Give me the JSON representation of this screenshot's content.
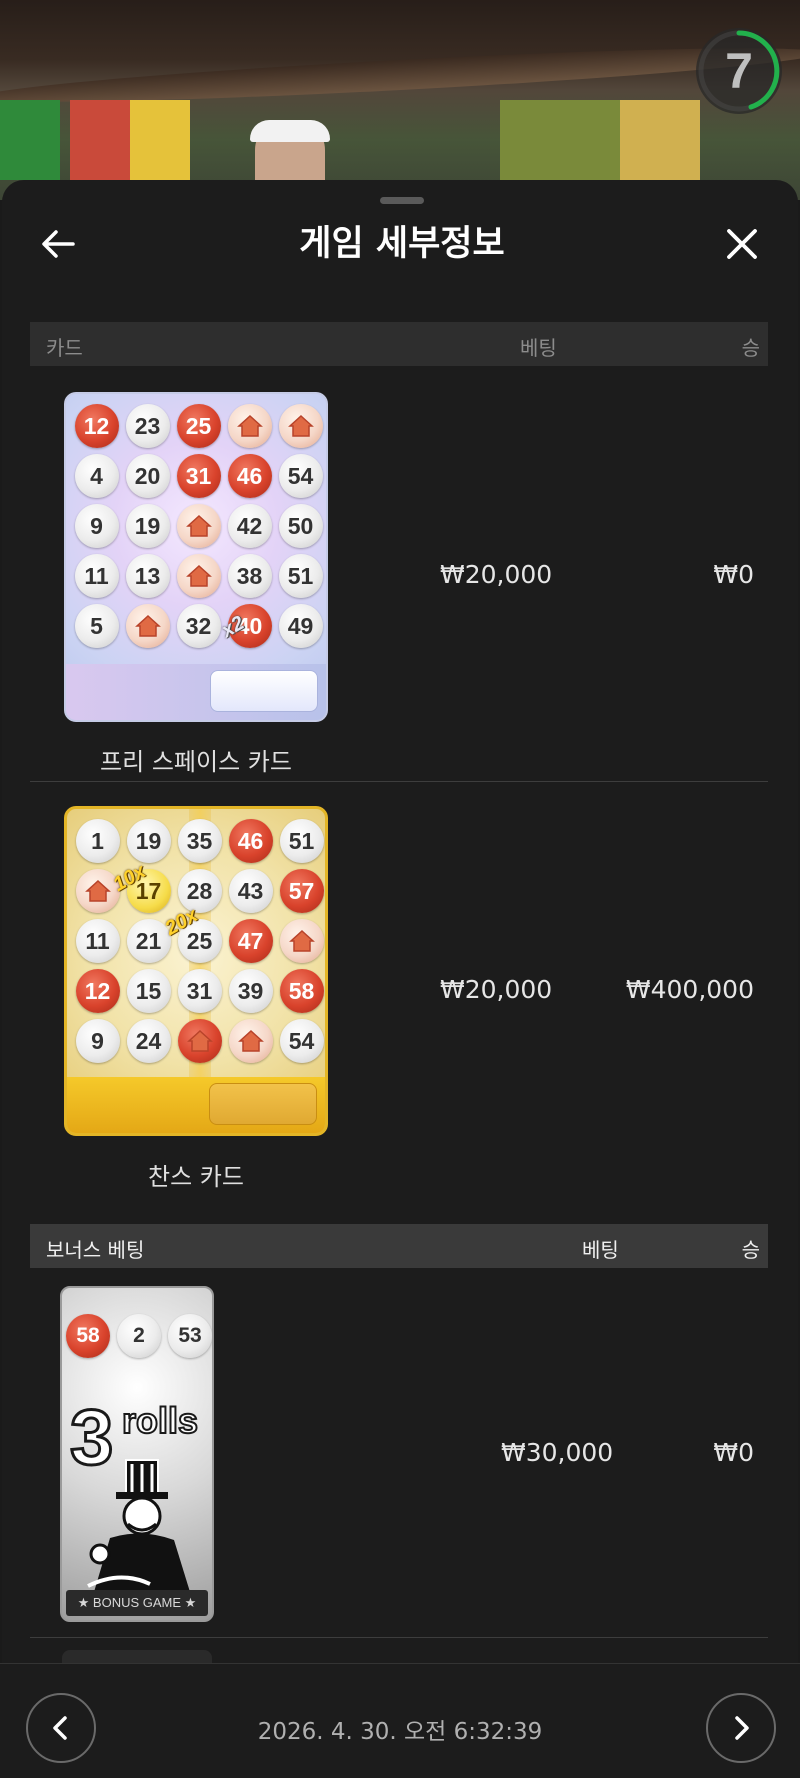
{
  "header": {
    "title": "게임 세부정보",
    "timer": "7"
  },
  "table": {
    "columns": {
      "card": "카드",
      "bet": "베팅",
      "win": "승"
    },
    "rows": [
      {
        "card_name": "프리 스페이스 카드",
        "bet": "₩20,000",
        "win": "₩0",
        "multiplier_labels": [
          "x2"
        ],
        "grid": [
          {
            "v": "12",
            "s": "hit"
          },
          {
            "v": "23",
            "s": "plain"
          },
          {
            "v": "25",
            "s": "hit"
          },
          {
            "v": "",
            "s": "house"
          },
          {
            "v": "",
            "s": "house"
          },
          {
            "v": "4",
            "s": "plain"
          },
          {
            "v": "20",
            "s": "plain"
          },
          {
            "v": "31",
            "s": "hit"
          },
          {
            "v": "46",
            "s": "hit"
          },
          {
            "v": "54",
            "s": "plain"
          },
          {
            "v": "9",
            "s": "plain"
          },
          {
            "v": "19",
            "s": "plain"
          },
          {
            "v": "",
            "s": "house"
          },
          {
            "v": "42",
            "s": "plain"
          },
          {
            "v": "50",
            "s": "plain"
          },
          {
            "v": "11",
            "s": "plain"
          },
          {
            "v": "13",
            "s": "plain"
          },
          {
            "v": "",
            "s": "house"
          },
          {
            "v": "38",
            "s": "plain"
          },
          {
            "v": "51",
            "s": "plain"
          },
          {
            "v": "5",
            "s": "plain"
          },
          {
            "v": "",
            "s": "house"
          },
          {
            "v": "32",
            "s": "plain"
          },
          {
            "v": "40",
            "s": "hit"
          },
          {
            "v": "49",
            "s": "plain"
          }
        ]
      },
      {
        "card_name": "찬스 카드",
        "bet": "₩20,000",
        "win": "₩400,000",
        "multiplier_labels": [
          "10x",
          "20x"
        ],
        "grid": [
          {
            "v": "1",
            "s": "plain"
          },
          {
            "v": "19",
            "s": "plain"
          },
          {
            "v": "35",
            "s": "plain"
          },
          {
            "v": "46",
            "s": "hit"
          },
          {
            "v": "51",
            "s": "plain"
          },
          {
            "v": "",
            "s": "house"
          },
          {
            "v": "17",
            "s": "gold"
          },
          {
            "v": "28",
            "s": "plain"
          },
          {
            "v": "43",
            "s": "plain"
          },
          {
            "v": "57",
            "s": "hit"
          },
          {
            "v": "11",
            "s": "plain"
          },
          {
            "v": "21",
            "s": "plain"
          },
          {
            "v": "25",
            "s": "plain"
          },
          {
            "v": "47",
            "s": "hit"
          },
          {
            "v": "",
            "s": "house"
          },
          {
            "v": "12",
            "s": "hit"
          },
          {
            "v": "15",
            "s": "plain"
          },
          {
            "v": "31",
            "s": "plain"
          },
          {
            "v": "39",
            "s": "plain"
          },
          {
            "v": "58",
            "s": "hit"
          },
          {
            "v": "9",
            "s": "plain"
          },
          {
            "v": "24",
            "s": "plain"
          },
          {
            "v": "",
            "s": "house-hit"
          },
          {
            "v": "",
            "s": "house"
          },
          {
            "v": "54",
            "s": "plain"
          }
        ]
      }
    ]
  },
  "bonus_table": {
    "columns": {
      "card": "보너스 베팅",
      "bet": "베팅",
      "win": "승"
    },
    "rows": [
      {
        "balls": [
          "58",
          "2",
          "53"
        ],
        "rolls_count": "3",
        "rolls_word": "rolls",
        "banner": "★ BONUS GAME ★",
        "bet": "₩30,000",
        "win": "₩0"
      }
    ]
  },
  "footer": {
    "timestamp": "2026. 4. 30. 오전 6:32:39"
  },
  "icons": {
    "back": "arrow-left-icon",
    "close": "close-icon",
    "prev": "chevron-left-icon",
    "next": "chevron-right-icon"
  },
  "colors": {
    "background": "#1c1c1c",
    "header_row": "#2e2e2e",
    "bonus_header_row": "#3a3a3a",
    "timer_ring": "#22b14c",
    "hit_ball": "#d9432c",
    "chance_border": "#e3b526"
  }
}
